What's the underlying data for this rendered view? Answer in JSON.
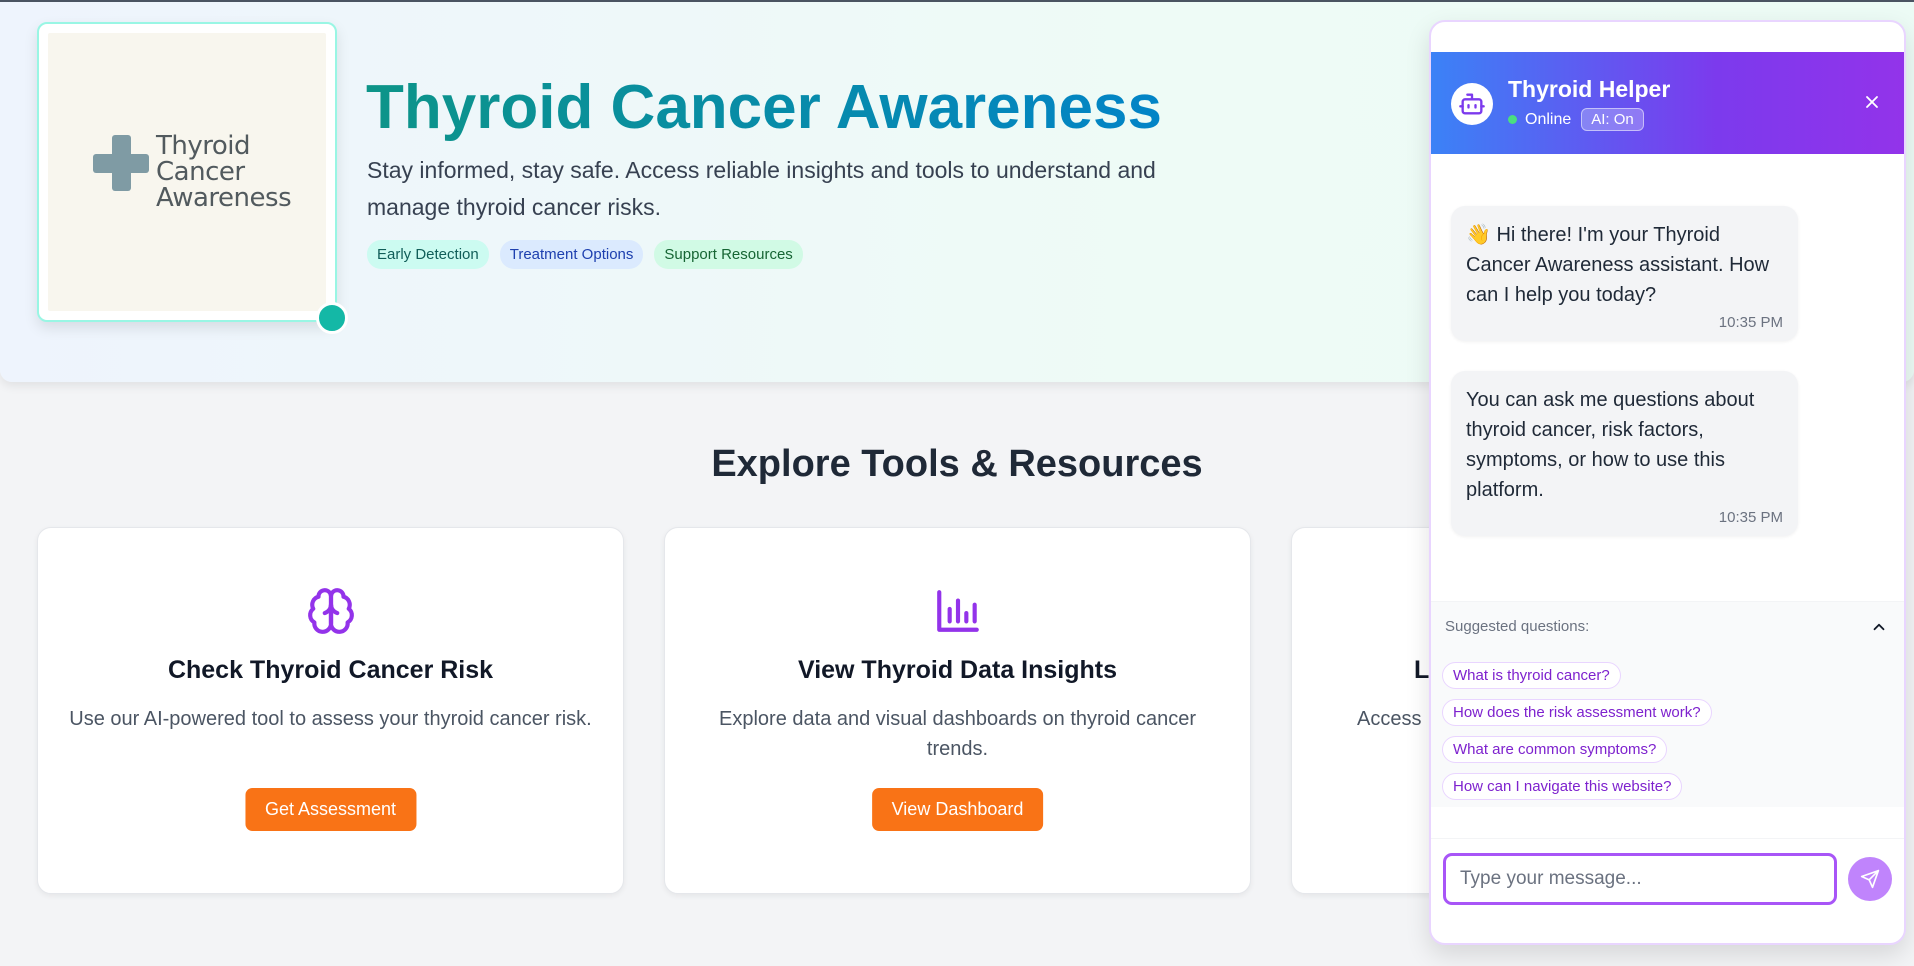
{
  "hero": {
    "logo_lines": [
      "Thyroid",
      "Cancer",
      "Awareness"
    ],
    "title": "Thyroid Cancer Awareness",
    "subtitle": "Stay informed, stay safe. Access reliable insights and tools to understand and manage thyroid cancer risks.",
    "tags": [
      "Early Detection",
      "Treatment Options",
      "Support Resources"
    ]
  },
  "section": {
    "title": "Explore Tools & Resources",
    "cards": [
      {
        "icon": "brain-icon",
        "title": "Check Thyroid Cancer Risk",
        "description": "Use our AI-powered tool to assess your thyroid cancer risk.",
        "button": "Get Assessment"
      },
      {
        "icon": "bar-chart-icon",
        "title": "View Thyroid Data Insights",
        "description": "Explore data and visual dashboards on thyroid cancer trends.",
        "button": "View Dashboard"
      },
      {
        "title": "L",
        "description": "Access"
      }
    ]
  },
  "chat": {
    "title": "Thyroid Helper",
    "status": "Online",
    "ai_badge": "AI: On",
    "messages": [
      {
        "text": "👋 Hi there! I'm your Thyroid Cancer Awareness assistant. How can I help you today?",
        "time": "10:35 PM"
      },
      {
        "text": "You can ask me questions about thyroid cancer, risk factors, symptoms, or how to use this platform.",
        "time": "10:35 PM"
      }
    ],
    "suggested_label": "Suggested questions:",
    "suggestions": [
      "What is thyroid cancer?",
      "How does the risk assessment work?",
      "What are common symptoms?",
      "How can I navigate this website?"
    ],
    "input_placeholder": "Type your message..."
  },
  "colors": {
    "accent_orange": "#f97316",
    "accent_purple": "#9333ea",
    "teal": "#14b8a6"
  }
}
